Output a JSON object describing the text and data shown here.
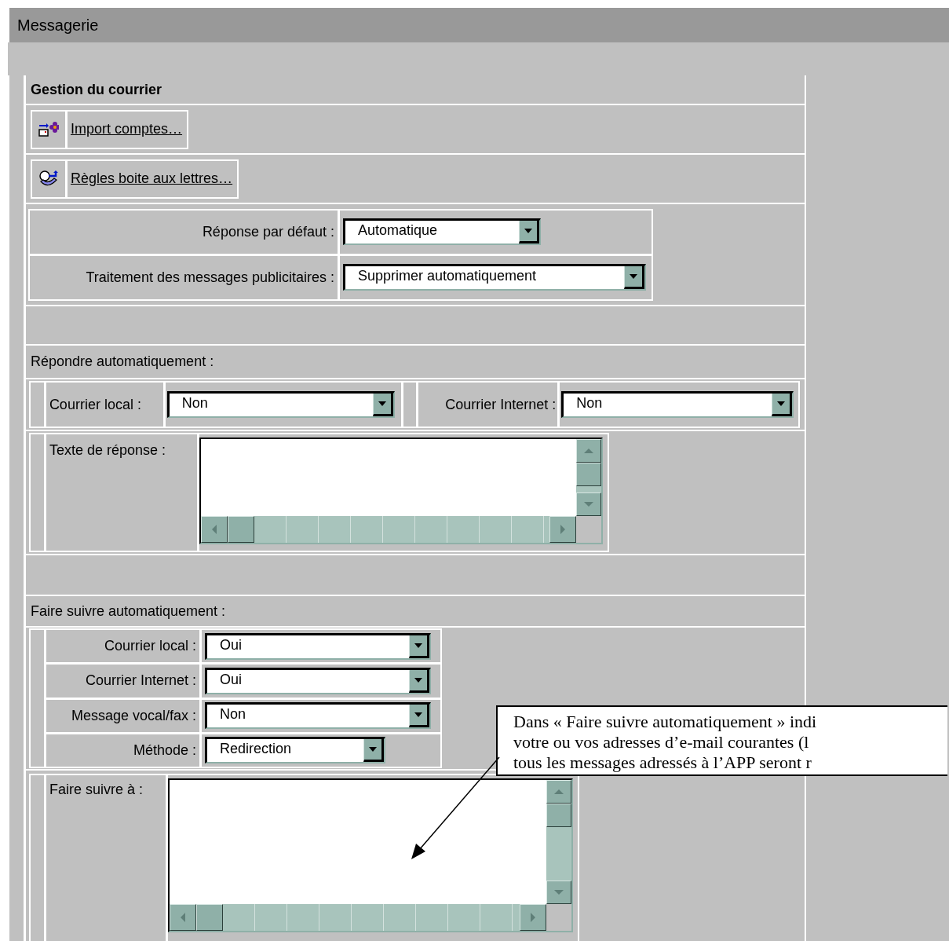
{
  "window": {
    "title": "Messagerie"
  },
  "section": {
    "title": "Gestion du courrier"
  },
  "actions": [
    {
      "kind": "import",
      "label": "Import comptes…"
    },
    {
      "kind": "rules",
      "label": "Règles boite aux lettres…"
    }
  ],
  "defaults": [
    {
      "label": "Réponse par défaut :",
      "value": "Automatique"
    },
    {
      "label": "Traitement des messages publicitaires :",
      "value": "Supprimer automatiquement"
    }
  ],
  "auto_reply": {
    "title": "Répondre automatiquement :",
    "fields": [
      {
        "label": "Courrier local :",
        "value": "Non"
      },
      {
        "label": "Courrier Internet :",
        "value": "Non"
      }
    ],
    "text_label": "Texte de réponse :"
  },
  "auto_forward": {
    "title": "Faire suivre automatiquement :",
    "fields": [
      {
        "label": "Courrier local :",
        "value": "Oui"
      },
      {
        "label": "Courrier Internet :",
        "value": "Oui"
      },
      {
        "label": "Message vocal/fax :",
        "value": "Non"
      },
      {
        "label": "Méthode :",
        "value": "Redirection"
      }
    ],
    "target_label": "Faire suivre à :"
  },
  "callout": {
    "lines": [
      "Dans « Faire suivre automatiquement » indi",
      "votre ou vos adresses d’e-mail courantes (l",
      "tous les messages adressés à l’APP seront r"
    ]
  }
}
